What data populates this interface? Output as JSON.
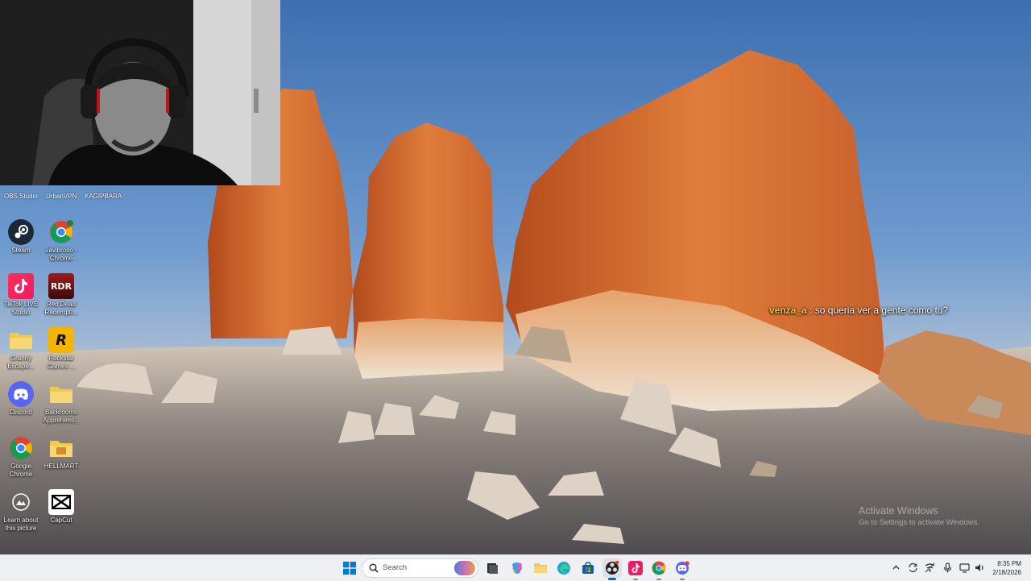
{
  "desktop": {
    "clipped_labels": [
      "OBS Studio",
      "UrbanVPN",
      "KAGIPBARA"
    ],
    "icons": [
      {
        "label": "Steam",
        "icon": "steam-icon",
        "color": "#1b2838"
      },
      {
        "label": "Javibroso - Chrome",
        "icon": "chrome-icon",
        "color": "#e8e8e8"
      },
      {
        "label": "TikTok LIVE Studio",
        "icon": "tiktok-live-icon",
        "color": "#e91e63"
      },
      {
        "label": "Red Dead Redempti...",
        "icon": "red-dead-icon",
        "color": "#7a1414"
      },
      {
        "label": "Granny Escape...",
        "icon": "folder-icon",
        "color": "#f2c94c"
      },
      {
        "label": "Rockstar Games ...",
        "icon": "rockstar-icon",
        "color": "#f4b400"
      },
      {
        "label": "Discord",
        "icon": "discord-icon",
        "color": "#5865f2"
      },
      {
        "label": "Backrooms Apprehens...",
        "icon": "folder-icon",
        "color": "#f2c94c"
      },
      {
        "label": "Google Chrome",
        "icon": "chrome-icon",
        "color": "#e8e8e8"
      },
      {
        "label": "HELLMART",
        "icon": "folder-icon",
        "color": "#f2c94c"
      },
      {
        "label": "Learn about this picture",
        "icon": "learn-picture-icon",
        "color": "transparent"
      },
      {
        "label": "CapCut",
        "icon": "capcut-icon",
        "color": "#000000"
      }
    ]
  },
  "chat": {
    "username": "venza_a",
    "separator": " : ",
    "message": "so queria ver a gente como tu?"
  },
  "watermark": {
    "line1": "Activate Windows",
    "line2": "Go to Settings to activate Windows."
  },
  "taskbar": {
    "search_placeholder": "Search",
    "apps": [
      "start-icon",
      "file-explorer-icon",
      "copilot-icon",
      "folder-icon",
      "edge-icon",
      "store-icon",
      "obs-icon",
      "tiktok-icon",
      "chrome-icon",
      "discord-icon"
    ],
    "tray": [
      "chevron-up-icon",
      "sync-icon",
      "network-icon",
      "microphone-icon",
      "display-icon",
      "volume-icon"
    ],
    "time": "8:35 PM",
    "date": "2/18/2026",
    "accent_color": "#0067c0"
  }
}
